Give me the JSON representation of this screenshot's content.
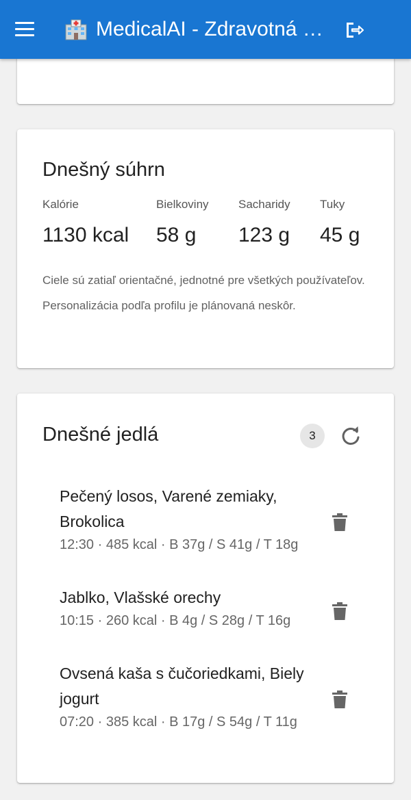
{
  "app": {
    "title": "MedicalAI - Zdravotná asistentka",
    "menu_icon": "menu-icon",
    "logo_icon": "hospital-icon",
    "logout_icon": "logout-icon"
  },
  "colors": {
    "appbar": "#1976d2",
    "background": "#f1f1f1",
    "card": "#ffffff"
  },
  "summary": {
    "title": "Dnešný súhrn",
    "stats": [
      {
        "label": "Kalórie",
        "value": "1130 kcal"
      },
      {
        "label": "Bielkoviny",
        "value": "58 g"
      },
      {
        "label": "Sacharidy",
        "value": "123 g"
      },
      {
        "label": "Tuky",
        "value": "45 g"
      }
    ],
    "note": "Ciele sú zatiaľ orientačné, jednotné pre všetkých používateľov. Personalizácia podľa profilu je plánovaná neskôr."
  },
  "meals": {
    "title": "Dnešné jedlá",
    "count": "3",
    "refresh_icon": "refresh-icon",
    "delete_icon": "trash-icon",
    "items": [
      {
        "name": "Pečený losos, Varené zemiaky, Brokolica",
        "meta": "12:30 · 485 kcal · B 37g / S 41g / T 18g"
      },
      {
        "name": "Jablko, Vlašské orechy",
        "meta": "10:15 · 260 kcal · B 4g / S 28g / T 16g"
      },
      {
        "name": "Ovsená kaša s čučoriedkami, Biely jogurt",
        "meta": "07:20 · 385 kcal · B 17g / S 54g / T 11g"
      }
    ]
  }
}
